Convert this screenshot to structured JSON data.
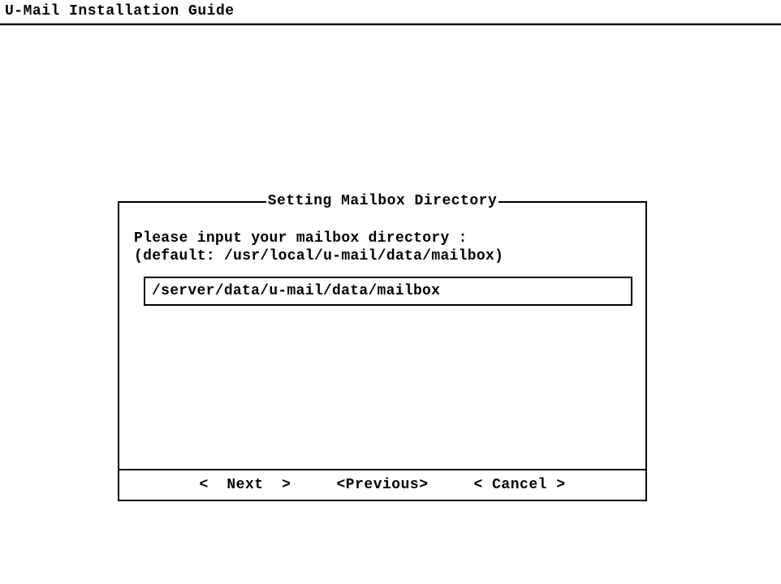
{
  "header": {
    "title": "U-Mail Installation Guide"
  },
  "dialog": {
    "title": "Setting Mailbox Directory",
    "prompt": "Please input your mailbox directory :",
    "default_hint": "(default: /usr/local/u-mail/data/mailbox)",
    "input_value": "/server/data/u-mail/data/mailbox"
  },
  "buttons": {
    "next": "<  Next  >",
    "previous": "<Previous>",
    "cancel": "< Cancel >"
  }
}
